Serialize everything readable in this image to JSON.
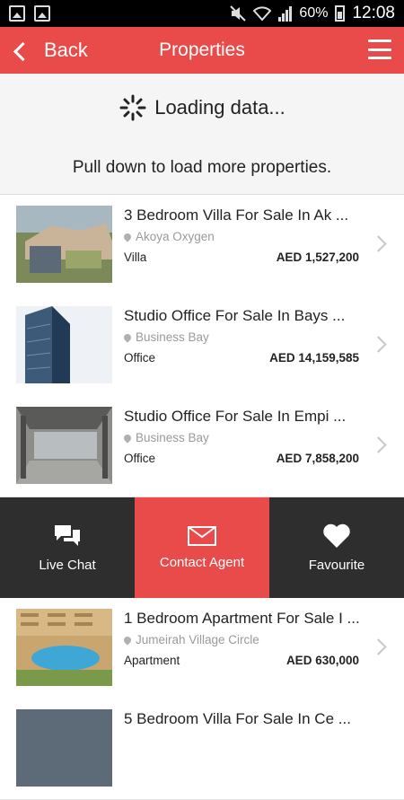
{
  "status_bar": {
    "battery": "60%",
    "time": "12:08"
  },
  "header": {
    "back_label": "Back",
    "title": "Properties"
  },
  "refresh": {
    "loading_text": "Loading data...",
    "pull_text": "Pull down to load more properties."
  },
  "listings": [
    {
      "title": "3 Bedroom Villa For Sale In Ak ...",
      "location": "Akoya Oxygen",
      "type": "Villa",
      "price": "AED 1,527,200"
    },
    {
      "title": "Studio Office For Sale In Bays ...",
      "location": "Business Bay",
      "type": "Office",
      "price": "AED 14,159,585"
    },
    {
      "title": "Studio Office For Sale In Empi ...",
      "location": "Business Bay",
      "type": "Office",
      "price": "AED 7,858,200"
    },
    {
      "title": "1 Bedroom Apartment For Sale I ...",
      "location": "Jumeirah Village Circle",
      "type": "Apartment",
      "price": "AED 630,000"
    },
    {
      "title": "5 Bedroom Villa For Sale In Ce ..."
    }
  ],
  "actions": {
    "live_chat": "Live Chat",
    "contact_agent": "Contact Agent",
    "favourite": "Favourite"
  },
  "colors": {
    "accent": "#e94b4b",
    "action_dark": "#2e2e2e"
  }
}
